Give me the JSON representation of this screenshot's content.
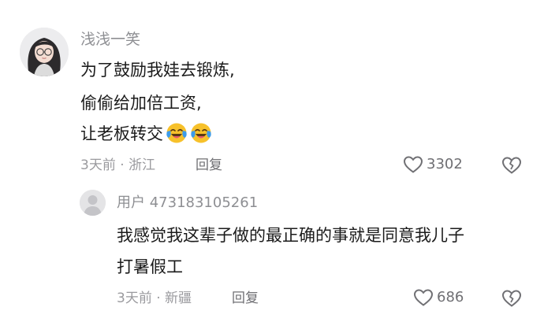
{
  "comment": {
    "username": "浅浅一笑",
    "lines": [
      "为了鼓励我娃去锻炼,",
      "偷偷给加倍工资,",
      "让老板转交"
    ],
    "emojis": [
      "laugh-cry-emoji",
      "laugh-cry-emoji"
    ],
    "meta": "3天前 · 浙江",
    "reply_label": "回复",
    "like_count": "3302"
  },
  "reply": {
    "username": "用户 473183105261",
    "lines": [
      "我感觉我这辈子做的最正确的事就是同意我儿子",
      "打暑假工"
    ],
    "meta": "3天前 · 新疆",
    "reply_label": "回复",
    "like_count": "686"
  },
  "icons": {
    "like": "heart-outline-icon",
    "dislike": "broken-heart-icon"
  }
}
